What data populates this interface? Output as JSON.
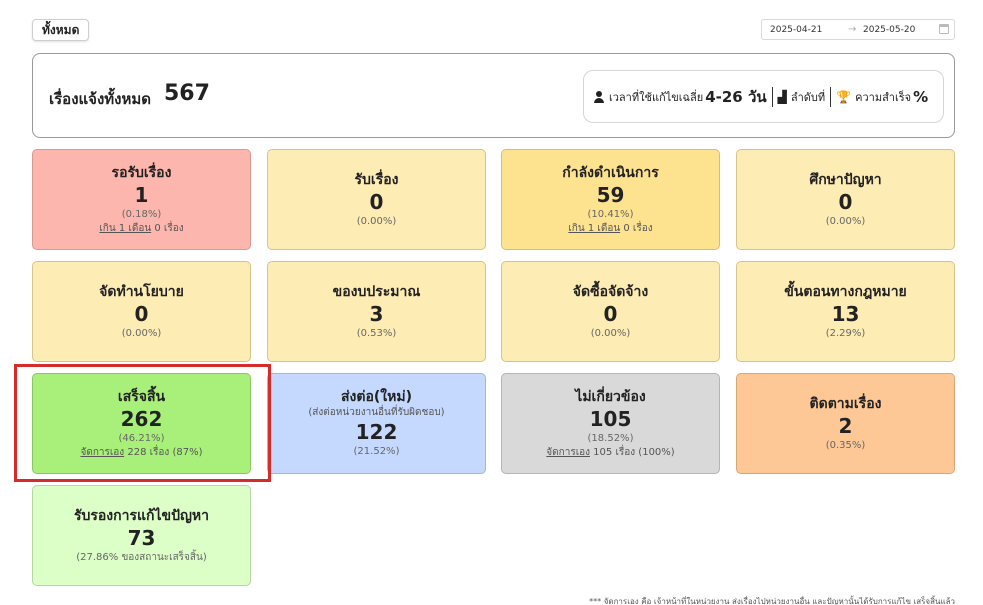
{
  "header": {
    "filter_label": "ทั้งหมด",
    "date_start": "2025-04-21",
    "date_arrow": "→",
    "date_end": "2025-05-20"
  },
  "summary": {
    "title": "เรื่องแจ้งทั้งหมด",
    "total": "567",
    "avg_time_label": "เวลาที่ใช้แก้ไขเฉลี่ย",
    "avg_time_value": "4-26 วัน",
    "rank_label": "ลำดับที่",
    "success_label": "ความสำเร็จ",
    "success_value": "%"
  },
  "cards": [
    {
      "label": "รอรับเรื่อง",
      "count": "1",
      "pct": "(0.18%)",
      "note_link": "เกิน 1 เดือน",
      "note_rest": " 0 เรื่อง",
      "bg": "#fdb6ad",
      "border": "#d79a92"
    },
    {
      "label": "รับเรื่อง",
      "count": "0",
      "pct": "(0.00%)",
      "bg": "#feecb5",
      "border": "#d8c488"
    },
    {
      "label": "กำลังดำเนินการ",
      "count": "59",
      "pct": "(10.41%)",
      "note_link": "เกิน 1 เดือน",
      "note_rest": " 0 เรื่อง",
      "bg": "#fde38f",
      "border": "#d6bf72"
    },
    {
      "label": "ศึกษาปัญหา",
      "count": "0",
      "pct": "(0.00%)",
      "bg": "#feecb5",
      "border": "#d8c488"
    },
    {
      "label": "จัดทำนโยบาย",
      "count": "0",
      "pct": "(0.00%)",
      "bg": "#feecb5",
      "border": "#d8c488"
    },
    {
      "label": "ของบประมาณ",
      "count": "3",
      "pct": "(0.53%)",
      "bg": "#feecb5",
      "border": "#d8c488"
    },
    {
      "label": "จัดซื้อจัดจ้าง",
      "count": "0",
      "pct": "(0.00%)",
      "bg": "#feecb5",
      "border": "#d8c488"
    },
    {
      "label": "ขั้นตอนทางกฎหมาย",
      "count": "13",
      "pct": "(2.29%)",
      "bg": "#feecb5",
      "border": "#d8c488"
    },
    {
      "label": "เสร็จสิ้น",
      "count": "262",
      "pct": "(46.21%)",
      "note_link": "จัดการเอง",
      "note_rest": " 228 เรื่อง (87%)",
      "bg": "#a9f07a",
      "border": "#8cc466"
    },
    {
      "label": "ส่งต่อ(ใหม่)",
      "sub": "(ส่งต่อหน่วยงานอื่นที่รับผิดชอบ)",
      "count": "122",
      "pct": "(21.52%)",
      "bg": "#c5d8fe",
      "border": "#a3b6d8"
    },
    {
      "label": "ไม่เกี่ยวข้อง",
      "count": "105",
      "pct": "(18.52%)",
      "note_link": "จัดการเอง",
      "note_rest": " 105 เรื่อง (100%)",
      "bg": "#d9d9d9",
      "border": "#b5b5b5"
    },
    {
      "label": "ติดตามเรื่อง",
      "count": "2",
      "pct": "(0.35%)",
      "bg": "#fec896",
      "border": "#d6a677"
    },
    {
      "label": "รับรองการแก้ไขปัญหา",
      "count": "73",
      "pct": "(27.86% ของสถานะเสร็จสิ้น)",
      "bg": "#dcfec7",
      "border": "#b6d6a2"
    }
  ],
  "footnote": "*** จัดการเอง คือ เจ้าหน้าที่ในหน่วยงาน ส่งเรื่องไปหน่วยงานอื่น และปัญหานั้นได้รับการแก้ไข เสร็จสิ้นแล้ว"
}
